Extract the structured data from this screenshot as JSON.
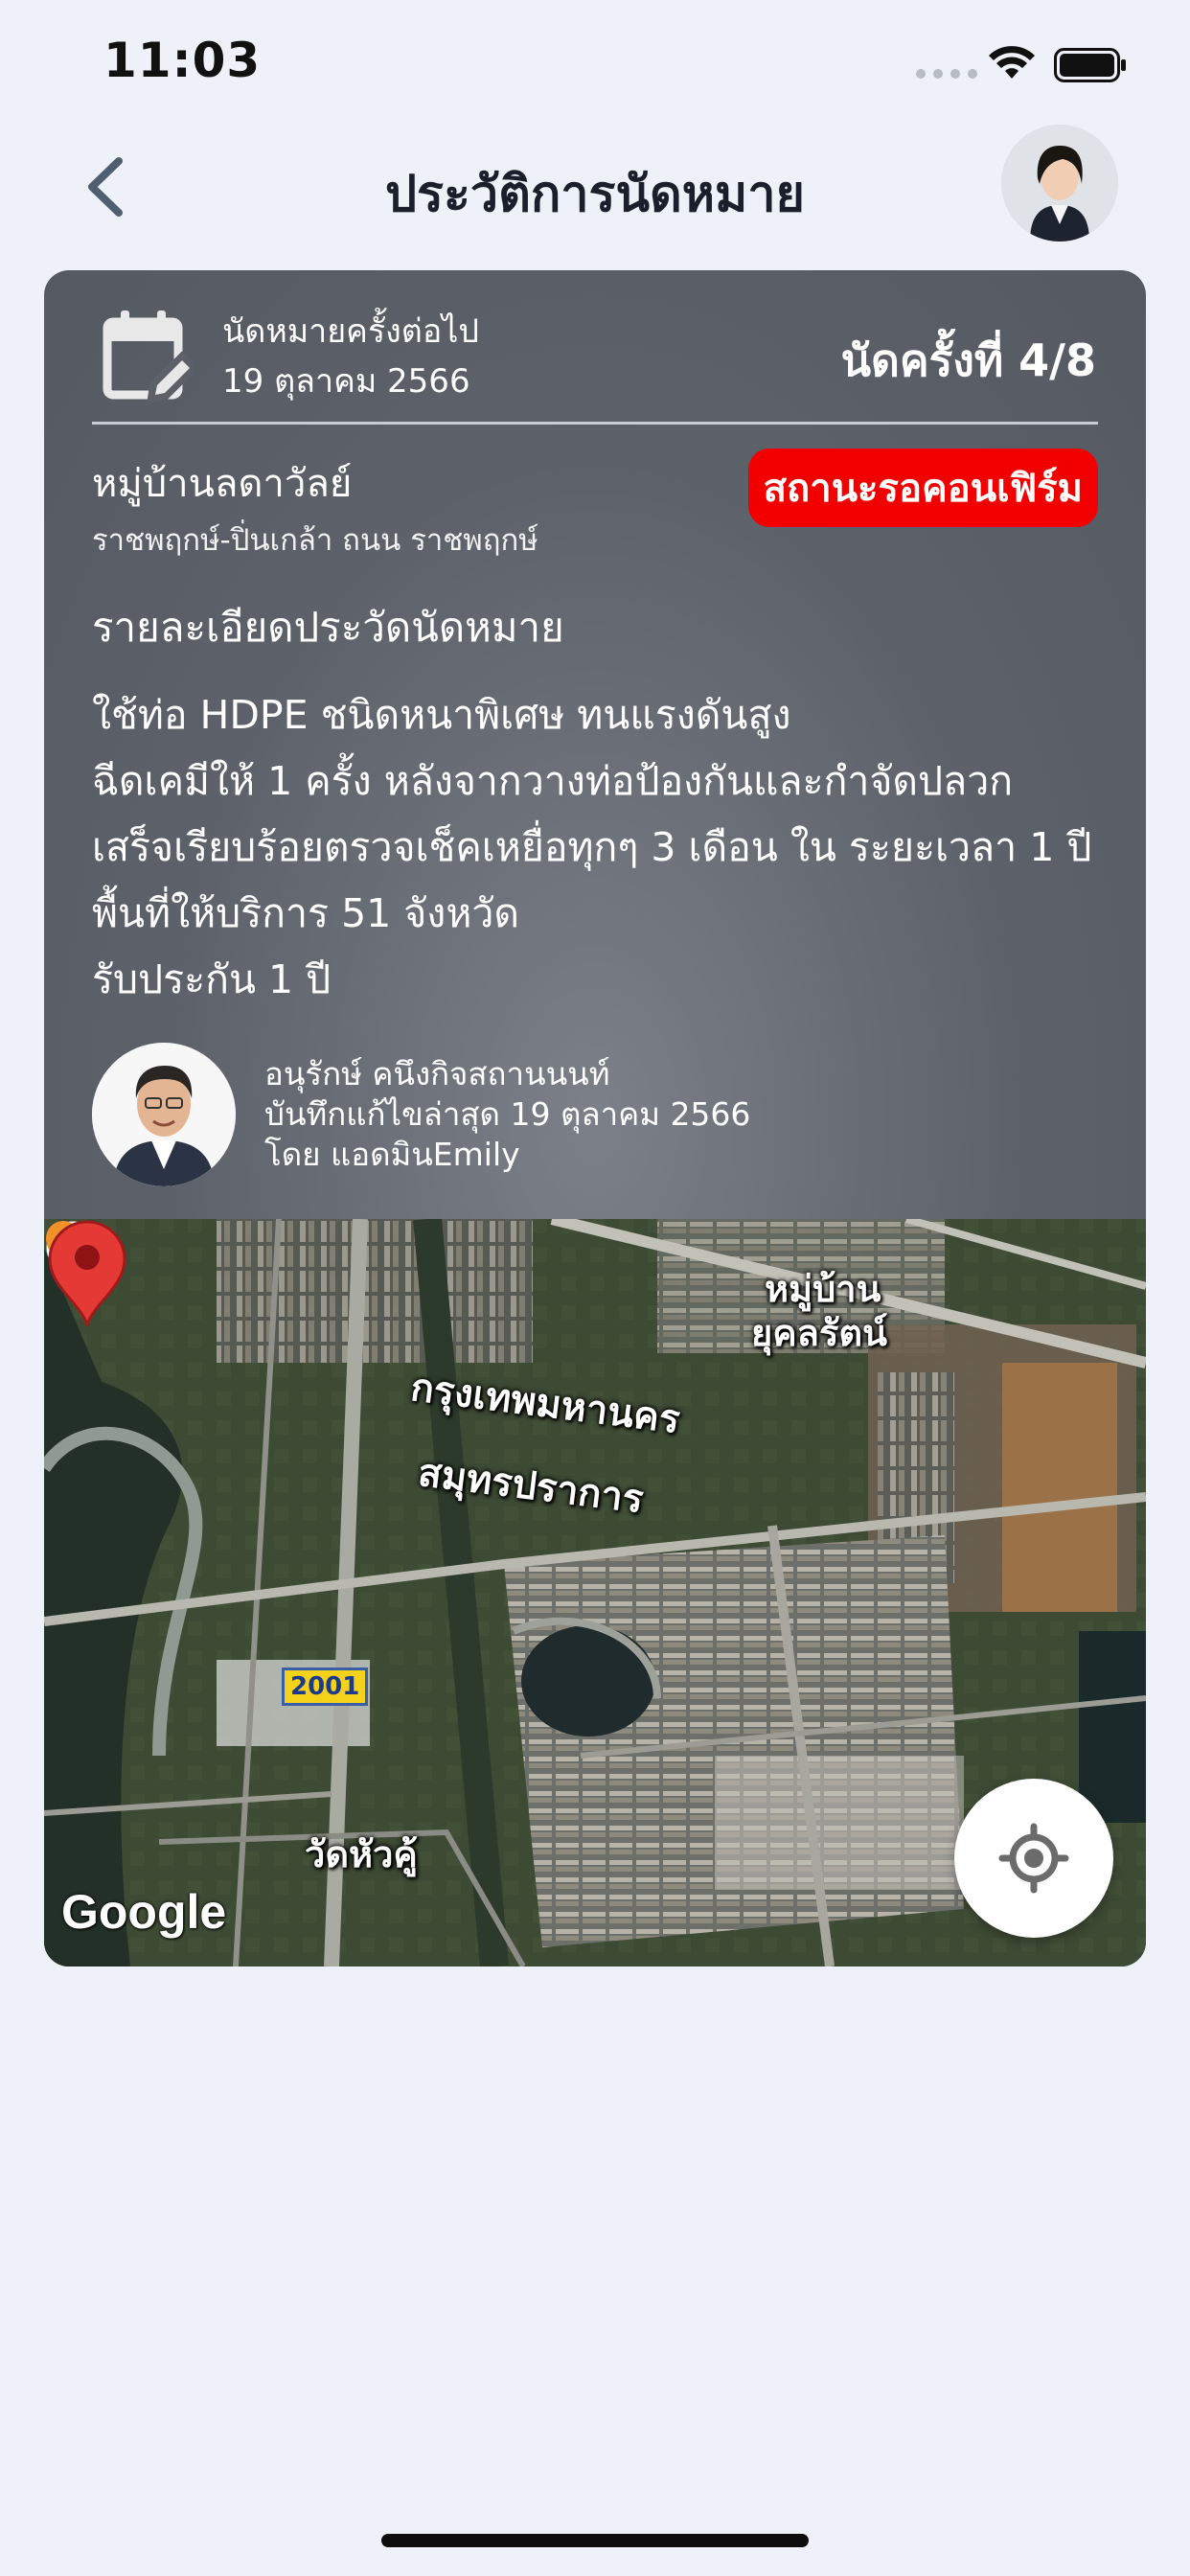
{
  "status_bar": {
    "time": "11:03"
  },
  "nav": {
    "title": "ประวัติการนัดหมาย"
  },
  "appointment": {
    "next_label": "นัดหมายครั้งต่อไป",
    "next_date": "19 ตุลาคม 2566",
    "visit_count": "นัดครั้งที่ 4/8",
    "village": "หมู่บ้านลดาวัลย์",
    "address": "ราชพฤกษ์-ปิ่นเกล้า ถนน ราชพฤกษ์",
    "status": "สถานะรอคอนเฟิร์ม",
    "status_color": "#f20000",
    "details_title": "รายละเอียดประวัดนัดหมาย",
    "details": [
      "ใช้ท่อ HDPE ชนิดหนาพิเศษ ทนแรงดันสูง",
      "ฉีดเคมีให้  1 ครั้ง หลังจากวางท่อป้องกันและกำจัดปลวก",
      "เสร็จเรียบร้อยตรวจเช็คเหยื่อทุกๆ  3 เดือน ใน ระยะเวลา 1  ปี",
      "พื้นที่ให้บริการ 51 จังหวัด",
      "รับประกัน 1 ปี"
    ],
    "author_name": "อนุรักษ์ คนึงกิจสถานนนท์",
    "author_edit": "บันทึกแก้ไขล่าสุด 19 ตุลาคม 2566",
    "author_by": "โดย แอดมินEmily"
  },
  "map": {
    "labels": {
      "village": "หมู่บ้าน",
      "village2": "ยุคลรัตน์",
      "bangkok": "กรุงเทพมหานคร",
      "samut": "สมุทรปราการ",
      "temple": "วัดหัวคู้",
      "road": "2001"
    },
    "provider": "Google"
  }
}
